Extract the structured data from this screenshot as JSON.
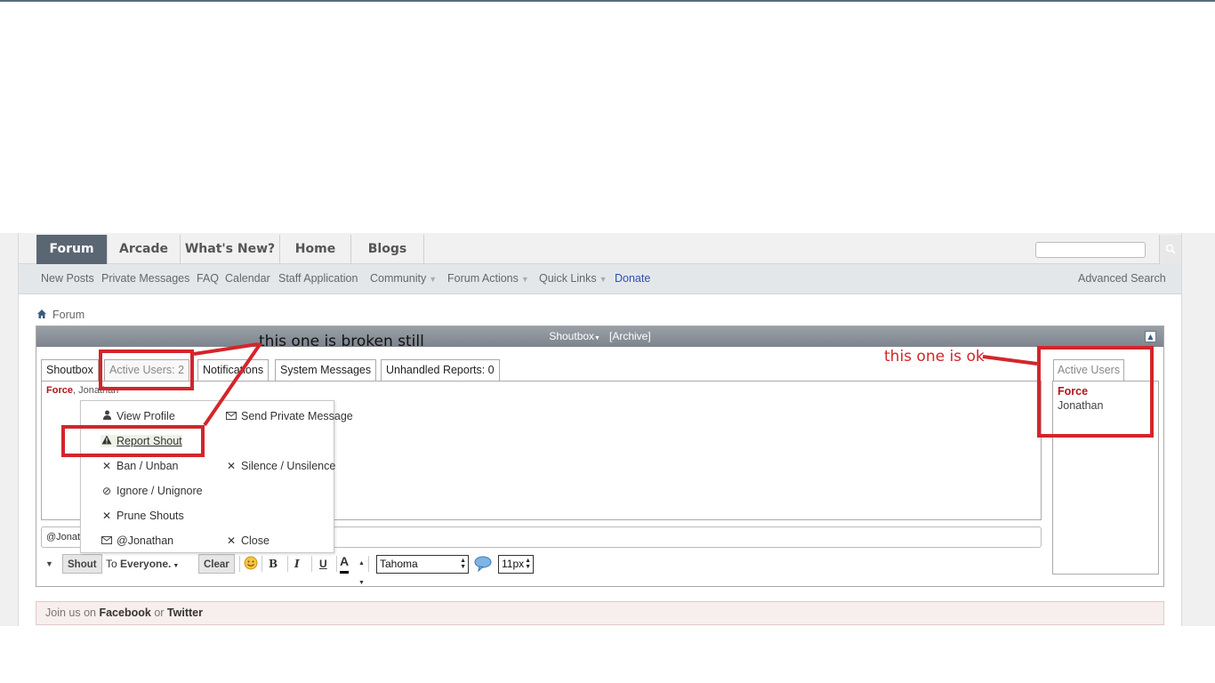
{
  "nav": {
    "tabs": [
      "Forum",
      "Arcade",
      "What's New?",
      "Home",
      "Blogs"
    ],
    "subnav": [
      "New Posts",
      "Private Messages",
      "FAQ",
      "Calendar",
      "Staff Application",
      "Community",
      "Forum Actions",
      "Quick Links",
      "Donate"
    ],
    "advanced_search": "Advanced Search"
  },
  "breadcrumb": {
    "label": "Forum"
  },
  "shoutbox": {
    "title": "Shoutbox",
    "archive": "[Archive]",
    "tabs": [
      "Shoutbox",
      "Active Users: 2",
      "Notifications",
      "System Messages",
      "Unhandled Reports: 0"
    ],
    "users_force": "Force",
    "users_rest": ", Jonathan",
    "input_value": "@Jonat",
    "toolbar": {
      "shout": "Shout",
      "to": "To",
      "everyone": "Everyone.",
      "clear": "Clear",
      "bold": "B",
      "italic": "I",
      "underline": "U",
      "color": "A",
      "font": "Tahoma",
      "size": "11px"
    }
  },
  "active_users": {
    "tab": "Active Users",
    "users": [
      "Force",
      "Jonathan"
    ]
  },
  "menu": {
    "view_profile": "View Profile",
    "send_pm": "Send Private Message",
    "report": "Report Shout",
    "ban": "Ban / Unban",
    "silence": "Silence / Unsilence",
    "ignore": "Ignore / Unignore",
    "prune": "Prune Shouts",
    "mention": "@Jonathan",
    "close": "Close"
  },
  "footer": {
    "join": "Join us on",
    "facebook": "Facebook",
    "or": "or",
    "twitter": "Twitter"
  },
  "annotations": {
    "broken": "this one is broken still",
    "ok": "this one is ok"
  },
  "colors": {
    "annotation": "#d3252b",
    "nav_active": "#5b6673",
    "user_force": "#b0151b"
  }
}
